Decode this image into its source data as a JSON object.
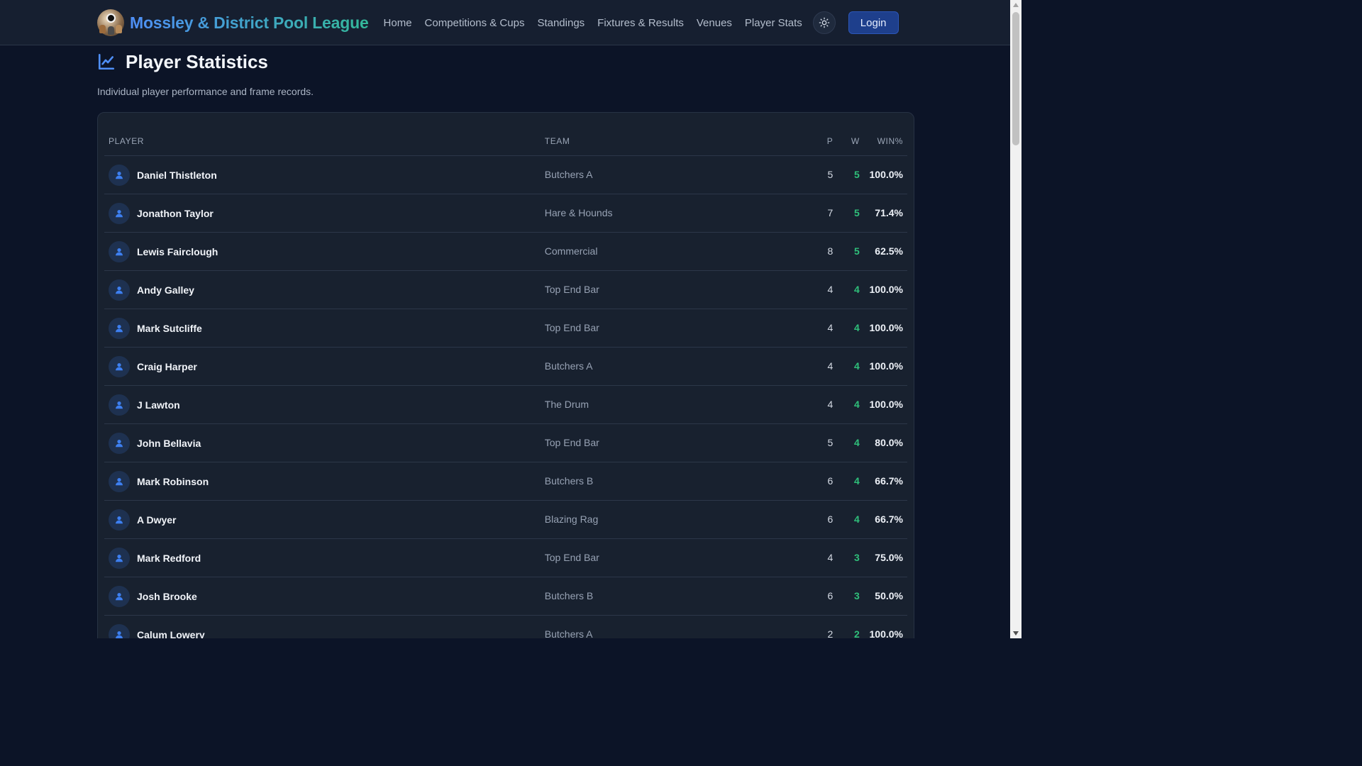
{
  "navbar": {
    "brand": "Mossley & District Pool League",
    "links": [
      "Home",
      "Competitions & Cups",
      "Standings",
      "Fixtures & Results",
      "Venues",
      "Player Stats"
    ],
    "login_label": "Login"
  },
  "page": {
    "title": "Player Statistics",
    "subtitle": "Individual player performance and frame records."
  },
  "table": {
    "headers": {
      "player": "PLAYER",
      "team": "TEAM",
      "p": "P",
      "w": "W",
      "win": "WIN%"
    },
    "rows": [
      {
        "player": "Daniel Thistleton",
        "team": "Butchers A",
        "p": "5",
        "w": "5",
        "win": "100.0%"
      },
      {
        "player": "Jonathon Taylor",
        "team": "Hare & Hounds",
        "p": "7",
        "w": "5",
        "win": "71.4%"
      },
      {
        "player": "Lewis Fairclough",
        "team": "Commercial",
        "p": "8",
        "w": "5",
        "win": "62.5%"
      },
      {
        "player": "Andy Galley",
        "team": "Top End Bar",
        "p": "4",
        "w": "4",
        "win": "100.0%"
      },
      {
        "player": "Mark Sutcliffe",
        "team": "Top End Bar",
        "p": "4",
        "w": "4",
        "win": "100.0%"
      },
      {
        "player": "Craig Harper",
        "team": "Butchers A",
        "p": "4",
        "w": "4",
        "win": "100.0%"
      },
      {
        "player": "J Lawton",
        "team": "The Drum",
        "p": "4",
        "w": "4",
        "win": "100.0%"
      },
      {
        "player": "John Bellavia",
        "team": "Top End Bar",
        "p": "5",
        "w": "4",
        "win": "80.0%"
      },
      {
        "player": "Mark Robinson",
        "team": "Butchers B",
        "p": "6",
        "w": "4",
        "win": "66.7%"
      },
      {
        "player": "A Dwyer",
        "team": "Blazing Rag",
        "p": "6",
        "w": "4",
        "win": "66.7%"
      },
      {
        "player": "Mark Redford",
        "team": "Top End Bar",
        "p": "4",
        "w": "3",
        "win": "75.0%"
      },
      {
        "player": "Josh Brooke",
        "team": "Butchers B",
        "p": "6",
        "w": "3",
        "win": "50.0%"
      },
      {
        "player": "Calum Lowery",
        "team": "Butchers A",
        "p": "2",
        "w": "2",
        "win": "100.0%"
      }
    ]
  },
  "icons": {
    "logo": "league-logo-icon",
    "theme": "sun-icon",
    "title": "line-chart-icon",
    "avatar": "user-icon"
  },
  "colors": {
    "background": "#0c1427",
    "navbar": "#161f30",
    "card": "#18212f",
    "accent_blue": "#4f8ff7",
    "wins_green": "#2fbf7a",
    "login_button": "#1e3f8c"
  }
}
